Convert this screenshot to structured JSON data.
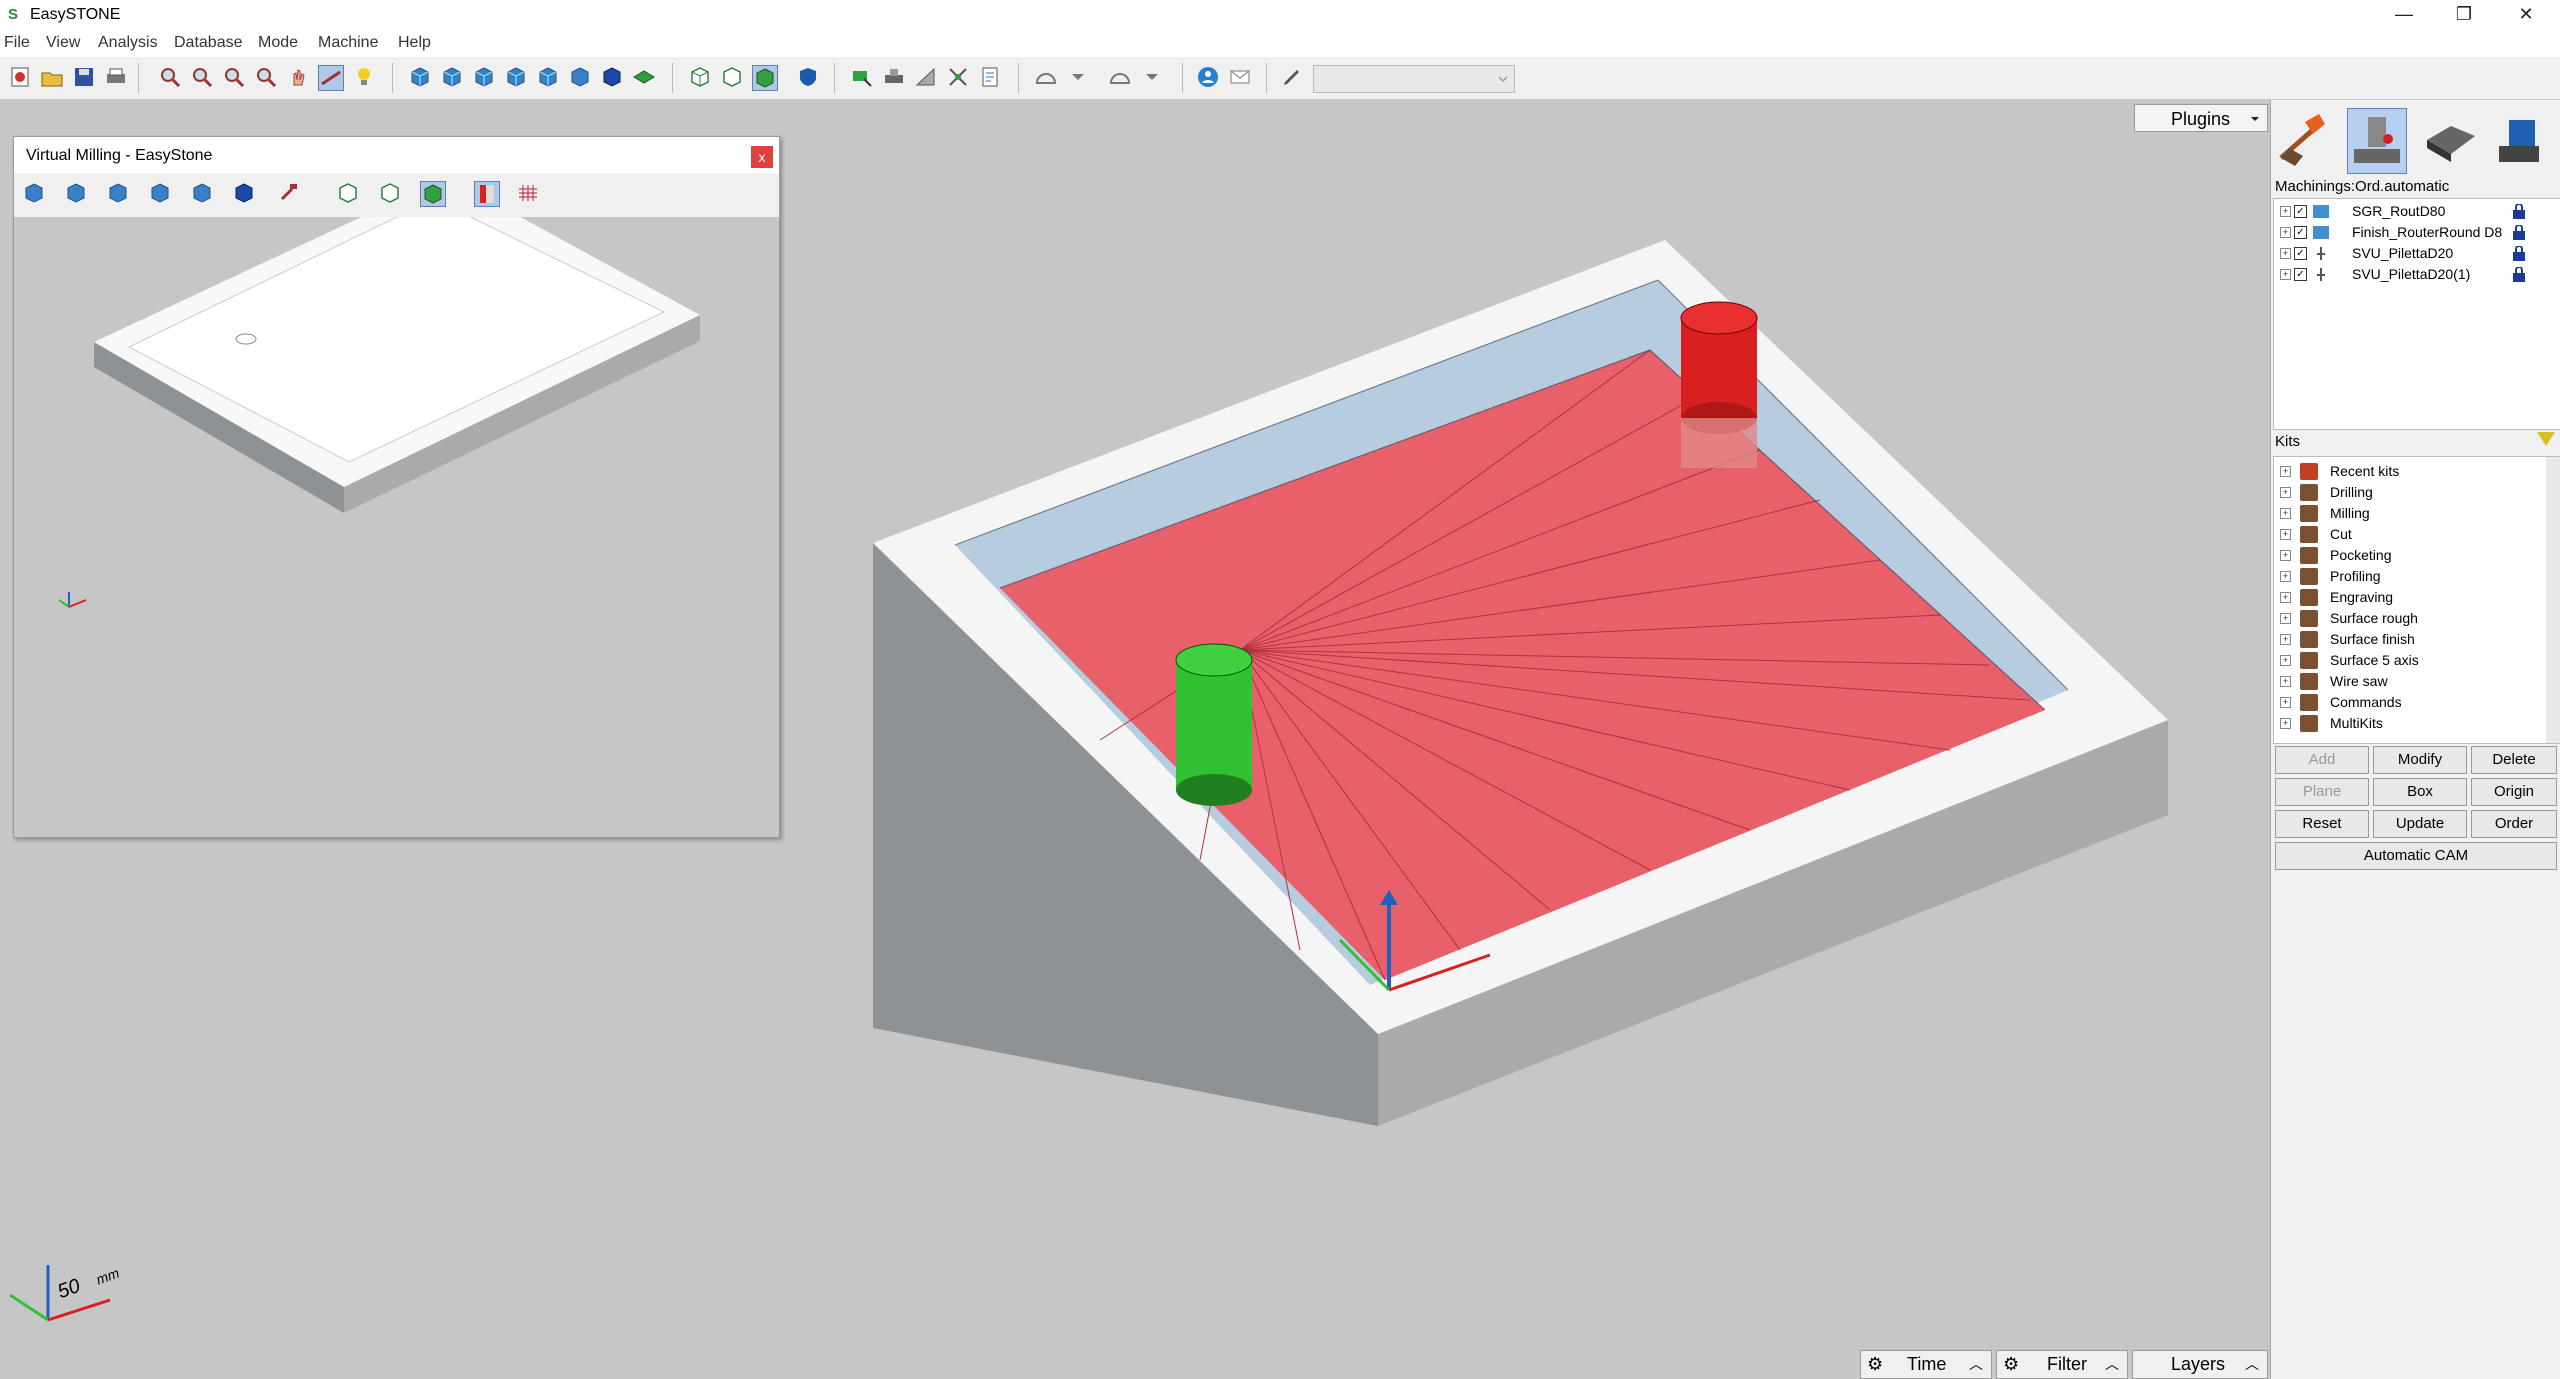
{
  "app": {
    "title": "EasySTONE",
    "logo": "S"
  },
  "window_controls": {
    "minimize": "—",
    "maximize": "❐",
    "close": "✕"
  },
  "menu": [
    "File",
    "View",
    "Analysis",
    "Database",
    "Mode",
    "Machine",
    "Help"
  ],
  "viewport": {
    "plugins_label": "Plugins",
    "scale_label": "50",
    "scale_unit": "mm"
  },
  "virtual_milling": {
    "title": "Virtual Milling - EasyStone",
    "close": "x"
  },
  "right_panel": {
    "machinings_label": "Machinings:Ord.automatic",
    "machinings": [
      "SGR_RoutD80",
      "Finish_RouterRound D8",
      "SVU_PilettaD20",
      "SVU_PilettaD20(1)"
    ],
    "kits_label": "Kits",
    "kits": [
      "Recent kits",
      "Drilling",
      "Milling",
      "Cut",
      "Pocketing",
      "Profiling",
      "Engraving",
      "Surface rough",
      "Surface finish",
      "Surface 5 axis",
      "Wire saw",
      "Commands",
      "MultiKits"
    ],
    "buttons": {
      "add": "Add",
      "modify": "Modify",
      "delete": "Delete",
      "plane": "Plane",
      "box": "Box",
      "origin": "Origin",
      "reset": "Reset",
      "update": "Update",
      "order": "Order",
      "automatic_cam": "Automatic CAM"
    }
  },
  "bottom_bar": {
    "time": "Time",
    "filter": "Filter",
    "layers": "Layers"
  },
  "colors": {
    "toolpath": "#e8606a",
    "tool_red": "#d82020",
    "tool_green": "#30c030",
    "slab": "#f5f5f5",
    "accent_blue": "#2060c0"
  }
}
